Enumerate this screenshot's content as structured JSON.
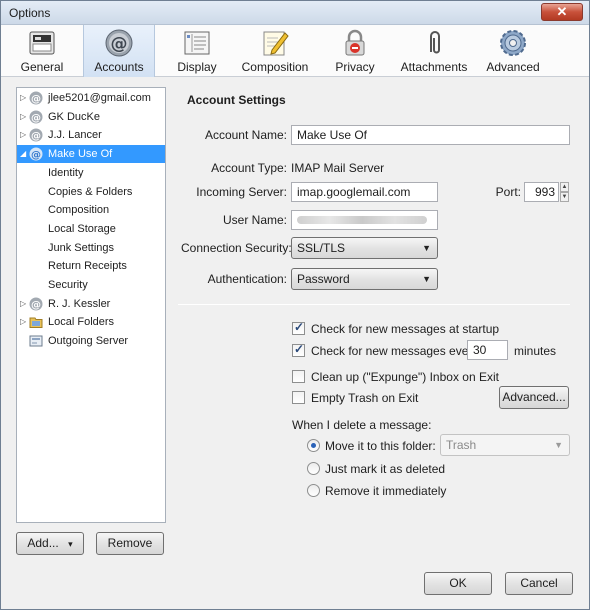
{
  "window": {
    "title": "Options",
    "close_glyph": "✕"
  },
  "toolbar": {
    "tabs": [
      {
        "label": "General",
        "icon": "general-icon"
      },
      {
        "label": "Accounts",
        "icon": "accounts-icon"
      },
      {
        "label": "Display",
        "icon": "display-icon"
      },
      {
        "label": "Composition",
        "icon": "composition-icon"
      },
      {
        "label": "Privacy",
        "icon": "privacy-icon"
      },
      {
        "label": "Attachments",
        "icon": "attachments-icon"
      },
      {
        "label": "Advanced",
        "icon": "advanced-icon"
      }
    ],
    "selected": "Accounts"
  },
  "sidebar": {
    "items": [
      {
        "label": "jlee5201@gmail.com",
        "twisty": "▷",
        "icon": "at-icon"
      },
      {
        "label": "GK DucKe",
        "twisty": "▷",
        "icon": "at-icon"
      },
      {
        "label": "J.J. Lancer",
        "twisty": "▷",
        "icon": "at-icon"
      },
      {
        "label": "Make Use Of",
        "twisty": "◢",
        "icon": "at-icon"
      },
      {
        "label": "Identity"
      },
      {
        "label": "Copies & Folders"
      },
      {
        "label": "Composition"
      },
      {
        "label": "Local Storage"
      },
      {
        "label": "Junk Settings"
      },
      {
        "label": "Return Receipts"
      },
      {
        "label": "Security"
      },
      {
        "label": "R. J. Kessler",
        "twisty": "▷",
        "icon": "at-icon"
      },
      {
        "label": "Local Folders",
        "twisty": "▷",
        "icon": "folder-icon"
      },
      {
        "label": "Outgoing Server",
        "icon": "server-icon"
      }
    ],
    "selected": "Make Use Of",
    "add_label": "Add...",
    "add_arrow": "▾",
    "remove_label": "Remove"
  },
  "settings": {
    "section_title": "Account Settings",
    "account_name_label": "Account Name:",
    "account_name_value": "Make Use Of",
    "account_type_label": "Account Type:",
    "account_type_value": "IMAP Mail Server",
    "incoming_server_label": "Incoming Server:",
    "incoming_server_value": "imap.googlemail.com",
    "port_label": "Port:",
    "port_value": "993",
    "user_name_label": "User Name:",
    "connection_security_label": "Connection Security:",
    "connection_security_value": "SSL/TLS",
    "authentication_label": "Authentication:",
    "authentication_value": "Password",
    "check_startup_label": "Check for new messages at startup",
    "check_every_label": "Check for new messages every",
    "check_every_value": "30",
    "minutes_label": "minutes",
    "cleanup_label": "Clean up (\"Expunge\") Inbox on Exit",
    "empty_trash_label": "Empty Trash on Exit",
    "advanced_button_label": "Advanced...",
    "delete_header": "When I delete a message:",
    "move_label": "Move it to this folder:",
    "move_folder_value": "Trash",
    "mark_deleted_label": "Just mark it as deleted",
    "remove_immediately_label": "Remove it immediately",
    "check_startup_checked": true,
    "check_every_checked": true,
    "cleanup_checked": false,
    "empty_trash_checked": false,
    "delete_option": "move"
  },
  "footer": {
    "ok_label": "OK",
    "cancel_label": "Cancel"
  },
  "colors": {
    "selection": "#3399ff",
    "check": "#2b4a7a"
  }
}
